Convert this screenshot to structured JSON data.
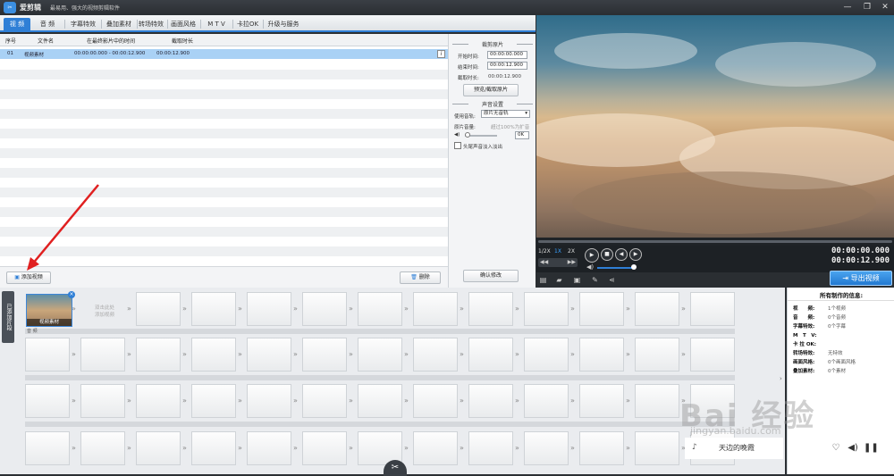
{
  "title": {
    "app": "爱剪辑",
    "slogan": "最易用、强大的视频剪辑软件"
  },
  "tabs": [
    "视 频",
    "音 频",
    "字幕特效",
    "叠加素材",
    "转场特效",
    "画面风格",
    "M T V",
    "卡拉OK",
    "升级与服务"
  ],
  "table": {
    "headers": [
      "序号",
      "文件名",
      "在最终影片中的时间",
      "截取时长"
    ],
    "rows": [
      [
        "01",
        "视频素材",
        "00:00:00.000 - 00:00:12.900",
        "00:00:12.900"
      ]
    ]
  },
  "buttons": {
    "add_video": "添加视频",
    "delete": "删除",
    "confirm": "确认修改",
    "preview_clip": "预览/截取原片",
    "export": "导出视频"
  },
  "clip": {
    "section_title": "裁剪原片",
    "start_label": "开始时间:",
    "start_value": "00:00:00.000",
    "end_label": "结束时间:",
    "end_value": "00:00:12.900",
    "duration_label": "截取时长:",
    "duration_value": "00:00:12.900"
  },
  "audio": {
    "section_title": "声音设置",
    "track_label": "使用音轨:",
    "track_value": "原片无音轨",
    "volume_label": "原片音量:",
    "volume_hint": "超过100%为扩音",
    "volume_value": "0K",
    "fade_label": "头尾声音淡入淡出"
  },
  "player": {
    "speeds": [
      "1/2X",
      "1X",
      "2X"
    ],
    "current_time": "00:00:00.000",
    "total_time": "00:00:12.900"
  },
  "timeline": {
    "side_tab": "已添加片段",
    "first_clip_label": "视频素材",
    "empty_hint": [
      "双击此处",
      "添加视频"
    ],
    "audio_track_label": "音 频"
  },
  "info": {
    "title": "所有制作的信息:",
    "items": [
      {
        "k": "视　　频:",
        "v": "1个视频"
      },
      {
        "k": "音　　频:",
        "v": "0个音频"
      },
      {
        "k": "字幕特效:",
        "v": "0个字幕"
      },
      {
        "k": "M　T　V:",
        "v": ""
      },
      {
        "k": "卡 拉 OK:",
        "v": ""
      },
      {
        "k": "转场特效:",
        "v": "无特效"
      },
      {
        "k": "画面风格:",
        "v": "0个画面风格"
      },
      {
        "k": "叠加素材:",
        "v": "0个素材"
      }
    ]
  },
  "watermark": {
    "main": "Bai 经验",
    "sub": "jingyan.baidu.com"
  },
  "ad": {
    "text": "天边的晚霞"
  },
  "colors": {
    "accent": "#2f7fd6",
    "selection": "#a9d1f5",
    "annotation_arrow": "#e02020"
  }
}
